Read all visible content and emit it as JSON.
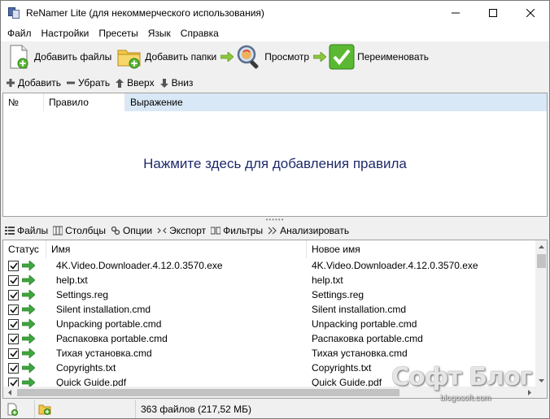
{
  "window": {
    "title": "ReNamer Lite (для некоммерческого использования)",
    "minimize_glyph": "─",
    "maximize_glyph": "☐",
    "close_glyph": "✕"
  },
  "menu": [
    "Файл",
    "Настройки",
    "Пресеты",
    "Язык",
    "Справка"
  ],
  "toolbar": {
    "add_files": "Добавить файлы",
    "add_folders": "Добавить папки",
    "preview": "Просмотр",
    "rename": "Переименовать"
  },
  "rule_toolbar": {
    "add": "Добавить",
    "remove": "Убрать",
    "up": "Вверх",
    "down": "Вниз"
  },
  "rules": {
    "columns": [
      "№",
      "Правило",
      "Выражение"
    ],
    "empty_hint": "Нажмите здесь для добавления правила"
  },
  "files_toolbar": {
    "files": "Файлы",
    "columns": "Столбцы",
    "options": "Опции",
    "export": "Экспорт",
    "filters": "Фильтры",
    "analyze": "Анализировать"
  },
  "files": {
    "columns": [
      "Статус",
      "Имя",
      "Новое имя"
    ],
    "rows": [
      {
        "name": "4K.Video.Downloader.4.12.0.3570.exe",
        "new_name": "4K.Video.Downloader.4.12.0.3570.exe"
      },
      {
        "name": "help.txt",
        "new_name": "help.txt"
      },
      {
        "name": "Settings.reg",
        "new_name": "Settings.reg"
      },
      {
        "name": "Silent installation.cmd",
        "new_name": "Silent installation.cmd"
      },
      {
        "name": "Unpacking portable.cmd",
        "new_name": "Unpacking portable.cmd"
      },
      {
        "name": "Распаковка portable.cmd",
        "new_name": "Распаковка portable.cmd"
      },
      {
        "name": "Тихая установка.cmd",
        "new_name": "Тихая установка.cmd"
      },
      {
        "name": "Copyrights.txt",
        "new_name": "Copyrights.txt"
      },
      {
        "name": "Quick Guide.pdf",
        "new_name": "Quick Guide.pdf"
      }
    ]
  },
  "status_bar": {
    "file_count": "363 файлов (217,52 МБ)"
  },
  "watermark": {
    "main": "Софт Блог",
    "sub": "blogosoft.com"
  },
  "colors": {
    "accent_header": "#d9e8f6",
    "hint_text": "#1f2a6b",
    "arrow_green": "#3ea63e",
    "check_green": "#5bb832"
  }
}
